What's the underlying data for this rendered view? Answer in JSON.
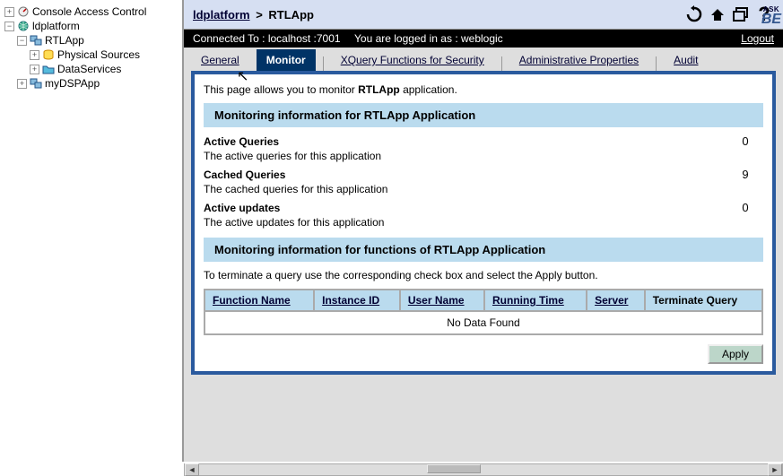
{
  "sidebar": {
    "items": [
      {
        "label": "Console Access Control",
        "icon": "dial",
        "toggle": "+",
        "indent": 0
      },
      {
        "label": "ldplatform",
        "icon": "globe",
        "toggle": "−",
        "indent": 0
      },
      {
        "label": "RTLApp",
        "icon": "app",
        "toggle": "−",
        "indent": 1
      },
      {
        "label": "Physical Sources",
        "icon": "db",
        "toggle": "+",
        "indent": 2
      },
      {
        "label": "DataServices",
        "icon": "folder",
        "toggle": "+",
        "indent": 2
      },
      {
        "label": "myDSPApp",
        "icon": "app",
        "toggle": "+",
        "indent": 1
      }
    ]
  },
  "breadcrumb": {
    "root": "ldplatform",
    "sep": ">",
    "current": "RTLApp"
  },
  "toolbar": {
    "ask": "ASK",
    "be": "BE"
  },
  "connbar": {
    "connected": "Connected To :  localhost :7001",
    "logged": "You are logged in as :  weblogic",
    "logout": "Logout"
  },
  "tabs": {
    "items": [
      {
        "label": "General"
      },
      {
        "label": "Monitor"
      },
      {
        "label": "XQuery Functions for Security"
      },
      {
        "label": "Administrative Properties"
      },
      {
        "label": "Audit"
      }
    ],
    "active": 1
  },
  "page": {
    "intro_pre": "This page allows you to monitor ",
    "intro_app": "RTLApp",
    "intro_post": " application.",
    "section1": "Monitoring information for RTLApp Application",
    "metrics": [
      {
        "label": "Active Queries",
        "desc": "The active queries for this application",
        "value": "0"
      },
      {
        "label": "Cached Queries",
        "desc": "The cached queries for this application",
        "value": "9"
      },
      {
        "label": "Active updates",
        "desc": "The active updates for this application",
        "value": "0"
      }
    ],
    "section2": "Monitoring information for functions of RTLApp Application",
    "terminate_instr": "To terminate a query use the corresponding check box and select the Apply button.",
    "columns": [
      {
        "label": "Function Name",
        "link": true
      },
      {
        "label": "Instance ID",
        "link": true
      },
      {
        "label": "User Name",
        "link": true
      },
      {
        "label": "Running Time",
        "link": true
      },
      {
        "label": "Server",
        "link": true
      },
      {
        "label": "Terminate Query",
        "link": false
      }
    ],
    "no_data": "No Data Found",
    "apply": "Apply"
  }
}
